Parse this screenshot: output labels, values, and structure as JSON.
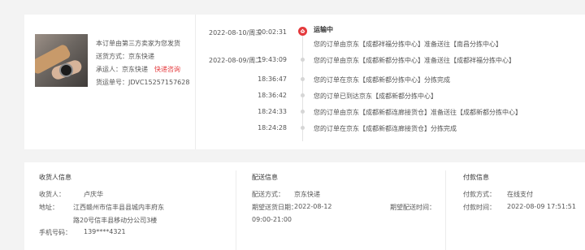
{
  "order": {
    "seller_note": "本订单由第三方卖家为您发货",
    "delivery_method": "送货方式：京东快递",
    "carrier_label": "承运人：京东快递",
    "carrier_link": "快递咨询",
    "tracking_number": "货运单号：JDVC15257157628"
  },
  "tracking": {
    "status": "运输中",
    "events": [
      {
        "date": "2022-08-10/周三",
        "time": "00:02:31",
        "desc": "您的订单由京东【成都祥福分拣中心】准备送往【南昌分拣中心】"
      },
      {
        "date": "2022-08-09/周二",
        "time": "19:43:09",
        "desc": "您的订单由京东【成都新都分拣中心】准备送往【成都祥福分拣中心】"
      },
      {
        "date": "",
        "time": "18:36:47",
        "desc": "您的订单在京东【成都新都分拣中心】分拣完成"
      },
      {
        "date": "",
        "time": "18:36:42",
        "desc": "您的订单已到达京东【成都新都分拣中心】"
      },
      {
        "date": "",
        "time": "18:24:33",
        "desc": "您的订单由京东【成都新都连廊接货仓】准备送往【成都新都分拣中心】"
      },
      {
        "date": "",
        "time": "18:24:28",
        "desc": "您的订单在京东【成都新都连廊接货仓】分拣完成"
      }
    ]
  },
  "recipient": {
    "title": "收货人信息",
    "name_label": "收货人：",
    "name_value": "卢庆华",
    "address_label": "地址：",
    "address_line1": "江西赣州市信丰县县城内丰府东",
    "address_line2": "路20号信丰县移动分公司3楼",
    "phone_label": "手机号码：",
    "phone_value": "139****4321"
  },
  "delivery": {
    "title": "配送信息",
    "method_label": "配送方式：",
    "method_value": "京东快递",
    "expected_label": "期望送货日期：",
    "expected_date": "2022-08-12",
    "expected_time": "09:00-21:00",
    "expected_time_label": "期望配送时间："
  },
  "payment": {
    "title": "付款信息",
    "method_label": "付款方式：",
    "method_value": "在线支付",
    "time_label": "付款时间：",
    "time_value": "2022-08-09 17:51:51"
  },
  "colors": {
    "accent": "#e4393c",
    "background": "#f3f3f3",
    "panel": "#ffffff"
  }
}
